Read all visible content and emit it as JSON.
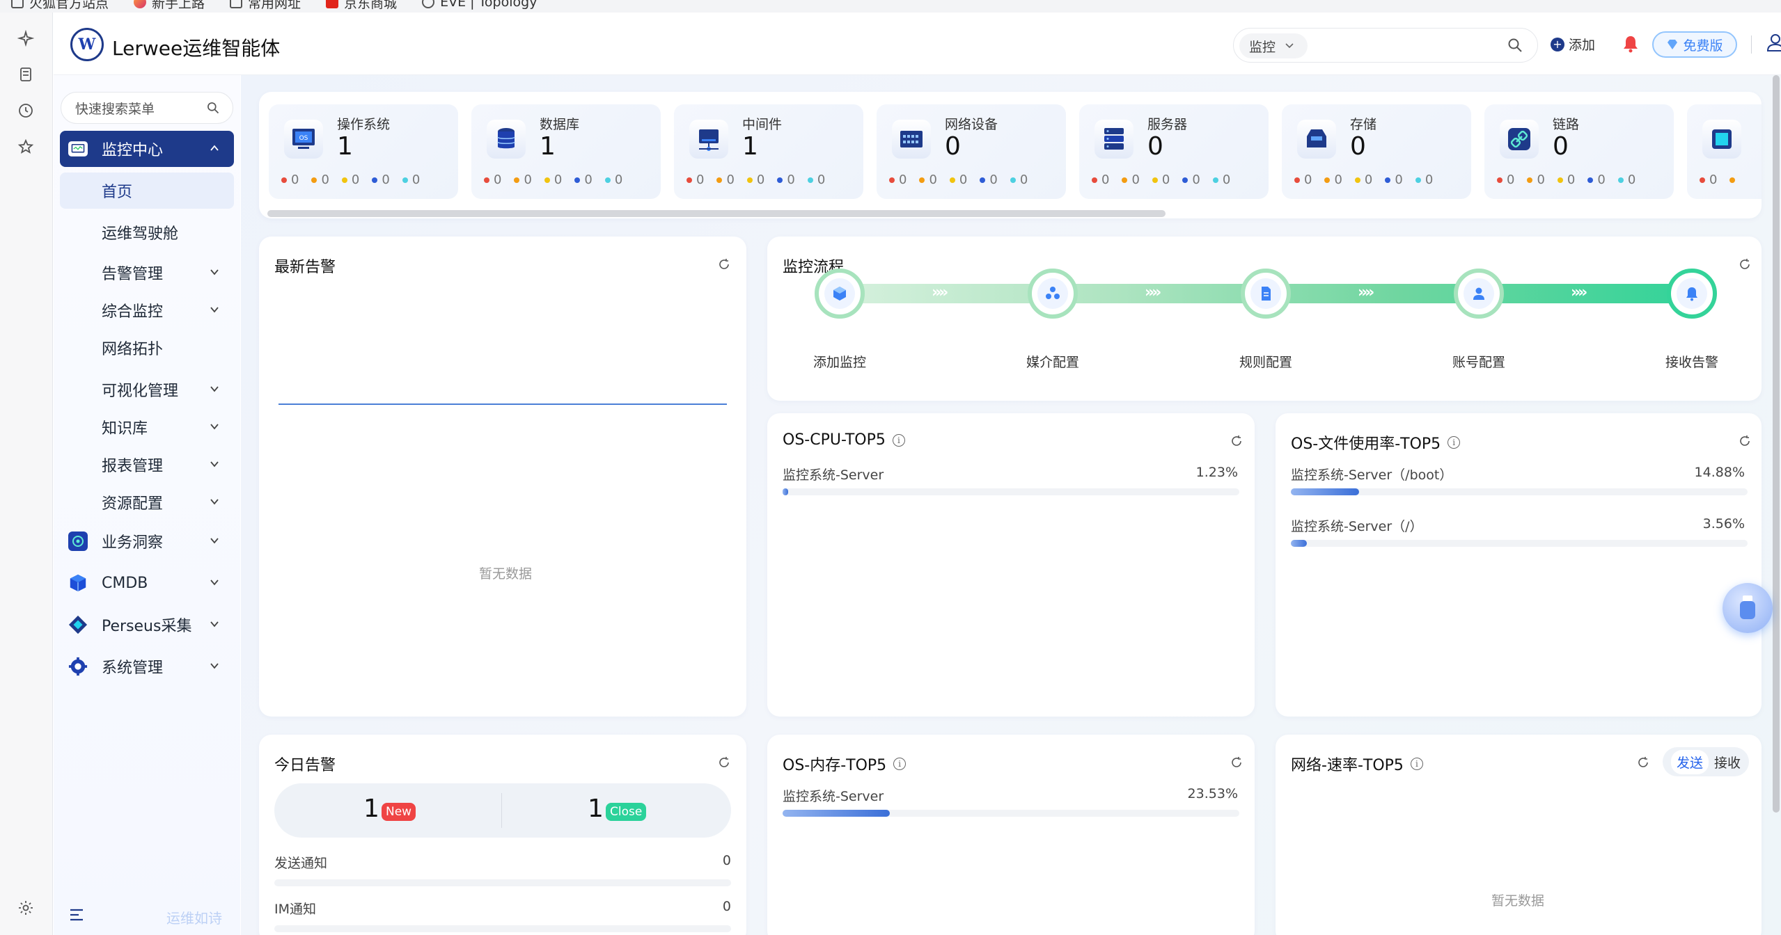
{
  "bookmarks": [
    "火狐官方站点",
    "新手上路",
    "常用网址",
    "京东商城",
    "EVE | Topology"
  ],
  "header": {
    "app_title": "Lerwee运维智能体",
    "logo_text": "W",
    "search_scope": "监控",
    "add_label": "添加",
    "free_badge": "免费版"
  },
  "sidebar": {
    "search_placeholder": "快速搜索菜单",
    "groups": [
      {
        "label": "监控中心",
        "icon": "monitor-icon",
        "active": true
      },
      {
        "label": "业务洞察",
        "icon": "insight-icon"
      },
      {
        "label": "CMDB",
        "icon": "cube-icon"
      },
      {
        "label": "Perseus采集",
        "icon": "collect-icon"
      },
      {
        "label": "系统管理",
        "icon": "gear-icon"
      }
    ],
    "sub_items": [
      {
        "label": "首页",
        "current": true
      },
      {
        "label": "运维驾驶舱"
      },
      {
        "label": "告警管理"
      },
      {
        "label": "综合监控"
      },
      {
        "label": "网络拓扑"
      },
      {
        "label": "可视化管理"
      },
      {
        "label": "知识库"
      },
      {
        "label": "报表管理"
      },
      {
        "label": "资源配置"
      }
    ],
    "slogan": "运维如诗"
  },
  "stats": {
    "items": [
      {
        "name": "操作系统",
        "count": "1",
        "icon": "os-icon"
      },
      {
        "name": "数据库",
        "count": "1",
        "icon": "database-icon"
      },
      {
        "name": "中间件",
        "count": "1",
        "icon": "middleware-icon"
      },
      {
        "name": "网络设备",
        "count": "0",
        "icon": "network-device-icon"
      },
      {
        "name": "服务器",
        "count": "0",
        "icon": "server-icon"
      },
      {
        "name": "存储",
        "count": "0",
        "icon": "storage-icon"
      },
      {
        "name": "链路",
        "count": "0",
        "icon": "link-icon"
      }
    ],
    "dot_values": [
      "0",
      "0",
      "0",
      "0",
      "0"
    ],
    "dot_colors": [
      "#e74c3c",
      "#f39c12",
      "#f1c40f",
      "#2e5cd6",
      "#4dd0e1"
    ]
  },
  "latest_alerts": {
    "title": "最新告警",
    "empty": "暂无数据"
  },
  "flow": {
    "title": "监控流程",
    "steps": [
      "添加监控",
      "媒介配置",
      "规则配置",
      "账号配置",
      "接收告警"
    ],
    "arrows": "››››"
  },
  "cpu_top5": {
    "title": "OS-CPU-TOP5",
    "rows": [
      {
        "name": "监控系统-Server",
        "value": "1.23%",
        "pct": 1.23
      }
    ]
  },
  "fs_top5": {
    "title": "OS-文件使用率-TOP5",
    "rows": [
      {
        "name": "监控系统-Server（/boot）",
        "value": "14.88%",
        "pct": 14.88
      },
      {
        "name": "监控系统-Server（/）",
        "value": "3.56%",
        "pct": 3.56
      }
    ]
  },
  "today": {
    "title": "今日告警",
    "new_count": "1",
    "new_label": "New",
    "close_count": "1",
    "close_label": "Close",
    "rows": [
      {
        "name": "发送通知",
        "value": "0"
      },
      {
        "name": "IM通知",
        "value": "0"
      }
    ]
  },
  "mem_top5": {
    "title": "OS-内存-TOP5",
    "rows": [
      {
        "name": "监控系统-Server",
        "value": "23.53%",
        "pct": 23.53
      }
    ]
  },
  "net_top5": {
    "title": "网络-速率-TOP5",
    "send": "发送",
    "receive": "接收",
    "empty": "暂无数据"
  }
}
